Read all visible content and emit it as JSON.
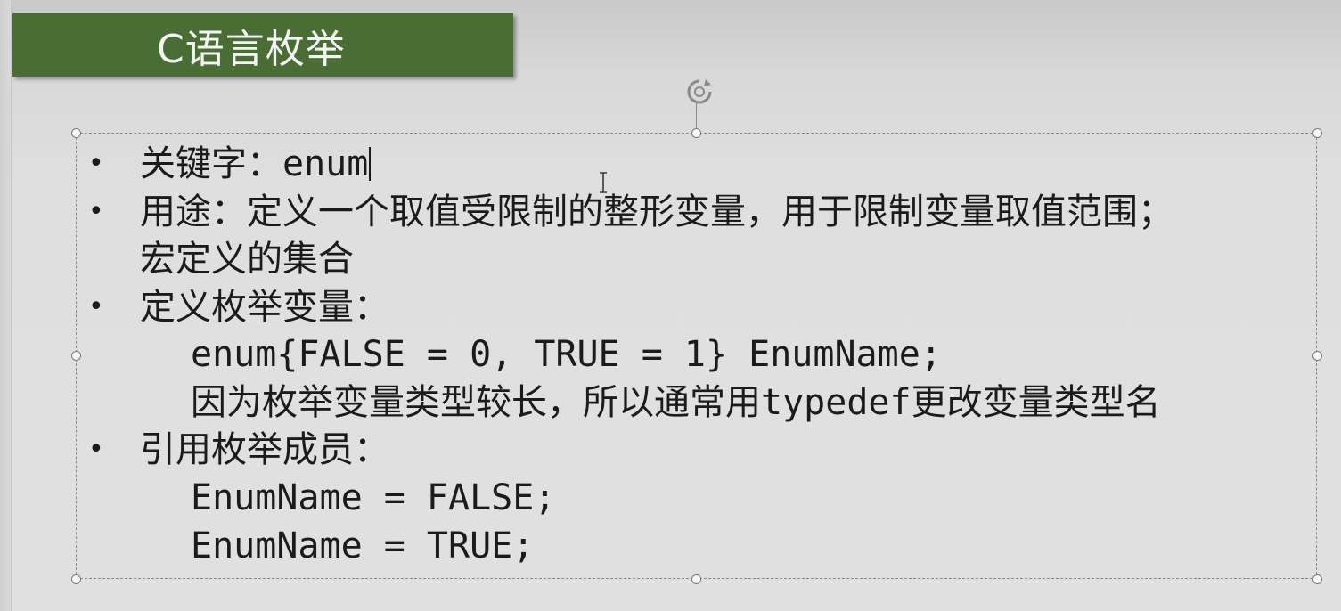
{
  "slide": {
    "title": "C语言枚举",
    "bullets": [
      {
        "label": "关键字：",
        "value": "enum"
      },
      {
        "line1": "用途：定义一个取值受限制的整形变量，用于限制变量取值范围；",
        "line2": "宏定义的集合"
      },
      {
        "label": "定义枚举变量：",
        "code": "enum{FALSE = 0, TRUE = 1} EnumName;",
        "note_prefix": "因为枚举变量类型较长，所以通常用",
        "note_keyword": "typedef",
        "note_suffix": "更改变量类型名"
      },
      {
        "label": "引用枚举成员：",
        "code_lines": [
          "EnumName = FALSE;",
          "EnumName = TRUE;"
        ]
      }
    ],
    "bullet_glyph": "•"
  },
  "colors": {
    "title_background": "#4a6d35",
    "title_text": "#f3f3f3",
    "body_text": "#1b1b1b",
    "selection_border": "#8a8a8a"
  },
  "icons": {
    "rotate": "rotate-handle-icon",
    "cursor": "text-cursor-ibeam"
  }
}
